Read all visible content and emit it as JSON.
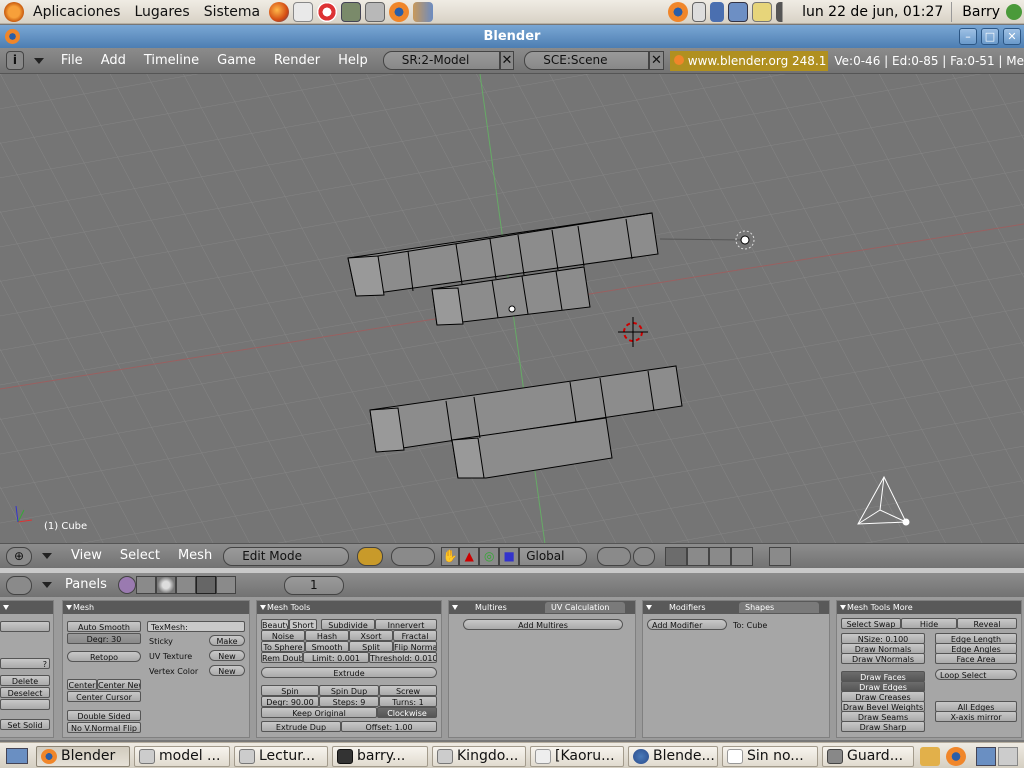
{
  "gnome": {
    "menus": [
      "Aplicaciones",
      "Lugares",
      "Sistema"
    ],
    "clock": "lun 22 de jun, 01:27",
    "user": "Barry"
  },
  "window": {
    "title": "Blender"
  },
  "header": {
    "menus": [
      "File",
      "Add",
      "Timeline",
      "Game",
      "Render",
      "Help"
    ],
    "screen": "SR:2-Model",
    "scene": "SCE:Scene",
    "url": "www.blender.org 248.1",
    "stats": "Ve:0-46 | Ed:0-85 | Fa:0-51 | Me"
  },
  "viewport": {
    "object_label": "(1) Cube",
    "menus": [
      "View",
      "Select",
      "Mesh"
    ],
    "mode": "Edit Mode",
    "orientation": "Global"
  },
  "buttons_header": {
    "panels_label": "Panels",
    "frame": "1"
  },
  "panel_left": {
    "btn_qmark": "?",
    "delete": "Delete",
    "deselect": "Deselect",
    "set_solid": "Set Solid"
  },
  "panel_mesh": {
    "title": "Mesh",
    "auto_smooth": "Auto Smooth",
    "degr": "Degr: 30",
    "retopo": "Retopo",
    "texmesh": "TexMesh:",
    "sticky": "Sticky",
    "make": "Make",
    "uv_texture": "UV Texture",
    "new1": "New",
    "vertex_color": "Vertex Color",
    "new2": "New",
    "center": "Center",
    "center_new": "Center New",
    "center_cursor": "Center Cursor",
    "double_sided": "Double Sided",
    "no_vnormal": "No V.Normal Flip"
  },
  "panel_meshtools": {
    "title": "Mesh Tools",
    "beauty": "Beauty",
    "short": "Short",
    "subdivide": "Subdivide",
    "innervert": "Innervert",
    "noise": "Noise",
    "hash": "Hash",
    "xsort": "Xsort",
    "fractal": "Fractal",
    "to_sphere": "To Sphere",
    "smooth": "Smooth",
    "split": "Split",
    "flip_normal": "Flip Normal",
    "rem_doubl": "Rem Doubl",
    "limit": "Limit: 0.001",
    "threshold": "Threshold: 0.010",
    "extrude": "Extrude",
    "spin": "Spin",
    "spin_dup": "Spin Dup",
    "screw": "Screw",
    "degr90": "Degr: 90.00",
    "steps": "Steps: 9",
    "turns": "Turns: 1",
    "keep_original": "Keep Original",
    "clockwise": "Clockwise",
    "extrude_dup": "Extrude Dup",
    "offset": "Offset: 1.00"
  },
  "panel_multires": {
    "tab1": "Multires",
    "tab2": "UV Calculation",
    "add": "Add Multires"
  },
  "panel_modifiers": {
    "tab1": "Modifiers",
    "tab2": "Shapes",
    "add": "Add Modifier",
    "to": "To: Cube"
  },
  "panel_more": {
    "title": "Mesh Tools More",
    "select_swap": "Select Swap",
    "hide": "Hide",
    "reveal": "Reveal",
    "nsize": "NSize: 0.100",
    "draw_normals": "Draw Normals",
    "draw_vnormals": "Draw VNormals",
    "edge_length": "Edge Length",
    "edge_angles": "Edge Angles",
    "face_area": "Face Area",
    "draw_faces": "Draw Faces",
    "draw_edges": "Draw Edges",
    "draw_creases": "Draw Creases",
    "draw_bevel": "Draw Bevel Weights",
    "draw_seams": "Draw Seams",
    "draw_sharp": "Draw Sharp",
    "loop_select": "Loop Select",
    "all_edges": "All Edges",
    "x_axis": "X-axis mirror"
  },
  "taskbar": {
    "tasks": [
      "Blender",
      "model ...",
      "Lectur...",
      "barry...",
      "Kingdo...",
      "[Kaoru...",
      "Blende...",
      "Sin no...",
      "Guard..."
    ]
  },
  "colors": {
    "grid_bg": "#757575",
    "face": "#8c8c8c",
    "header": "#7f7f7f",
    "panel": "#a6a6a6"
  }
}
